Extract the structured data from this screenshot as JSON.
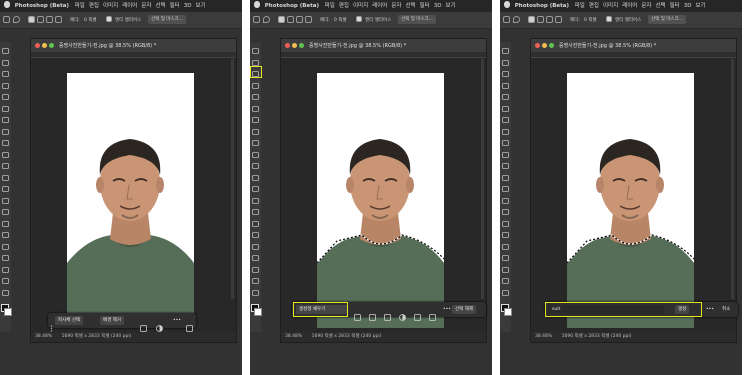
{
  "menubar": {
    "app_name": "Photoshop (Beta)",
    "items": [
      "파일",
      "편집",
      "이미지",
      "레이어",
      "문자",
      "선택",
      "필터",
      "3D",
      "보기"
    ]
  },
  "options": {
    "feather_label": "페더:",
    "feather_value": "0 픽셀",
    "antialias_label": "앤티 앨리어스",
    "select_mask_label": "선택 및 마스크..."
  },
  "document": {
    "title": "증명사진만들기-전.jpg @ 38.5% (RGB/8) *",
    "zoom": "38.48%",
    "dimensions": "1690 픽셀 x 2833 픽셀 (240 ppi)"
  },
  "panels": [
    {
      "context_bar": {
        "buttons": [
          "피사체 선택",
          "배경 제거"
        ],
        "more": "•••"
      }
    },
    {
      "context_bar": {
        "generative_fill": "생성형 채우기",
        "deselect": "선택 해제",
        "more": "•••"
      }
    },
    {
      "context_bar": {
        "prompt_value": "suit",
        "generate": "생성",
        "cancel": "취소",
        "more": "•••"
      }
    }
  ],
  "colors": {
    "highlight": "#e5e51b",
    "panel_bg": "#323232",
    "shirt": "#566d58"
  }
}
